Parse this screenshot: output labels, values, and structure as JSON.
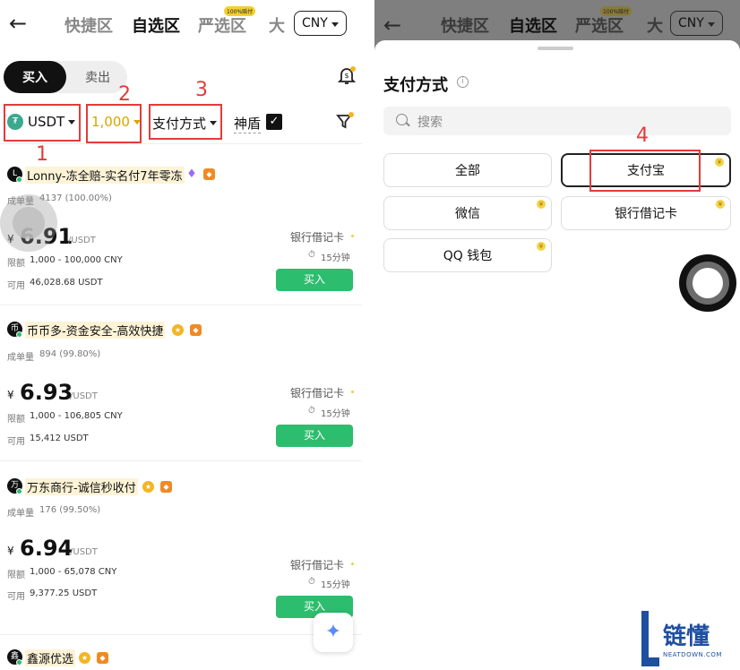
{
  "left": {
    "header": {
      "back": "←",
      "tabs": [
        "快捷区",
        "自选区",
        "严选区",
        "大"
      ],
      "active_tab": "自选区",
      "badge": "100%赔付",
      "currency": "CNY"
    },
    "segment": {
      "buy": "买入",
      "sell": "卖出"
    },
    "filters": {
      "coin": "USDT",
      "amount": "1,000",
      "payment": "支付方式",
      "shield": "神盾"
    },
    "annotations": [
      "1",
      "2",
      "3"
    ],
    "merchants": [
      {
        "avatar": "L",
        "name": "Lonny-冻全赔-实名付7年零冻",
        "stats_label": "成单量",
        "stats": "4137 (100.00%)",
        "currency_symbol": "¥",
        "price": "6.91",
        "unit": "/USDT",
        "pay_method": "银行借记卡",
        "time": "15分钟",
        "limit_label": "限额",
        "limit": "1,000 - 100,000 CNY",
        "avail_label": "可用",
        "avail": "46,028.68 USDT",
        "buy": "买入"
      },
      {
        "avatar": "币",
        "name": "币币多-资金安全-高效快捷",
        "stats_label": "成单量",
        "stats": "894 (99.80%)",
        "currency_symbol": "¥",
        "price": "6.93",
        "unit": "/USDT",
        "pay_method": "银行借记卡",
        "time": "15分钟",
        "limit_label": "限额",
        "limit": "1,000 - 106,805 CNY",
        "avail_label": "可用",
        "avail": "15,412 USDT",
        "buy": "买入"
      },
      {
        "avatar": "万",
        "name": "万东商行-诚信秒收付",
        "stats_label": "成单量",
        "stats": "176 (99.50%)",
        "currency_symbol": "¥",
        "price": "6.94",
        "unit": "/USDT",
        "pay_method": "银行借记卡",
        "time": "15分钟",
        "limit_label": "限额",
        "limit": "1,000 - 65,078 CNY",
        "avail_label": "可用",
        "avail": "9,377.25 USDT",
        "buy": "买入"
      },
      {
        "avatar": "鑫",
        "name": "鑫源优选"
      }
    ]
  },
  "right": {
    "header": {
      "back": "←",
      "tabs": [
        "快捷区",
        "自选区",
        "严选区",
        "大"
      ],
      "badge": "100%赔付",
      "currency": "CNY"
    },
    "sheet": {
      "title": "支付方式",
      "info": "i",
      "search_placeholder": "搜索",
      "options": [
        "全部",
        "支付宝",
        "微信",
        "银行借记卡",
        "QQ 钱包"
      ],
      "selected": "支付宝",
      "annotation": "4"
    },
    "watermark": {
      "text": "链懂",
      "url": "NEATDOWN.COM"
    }
  },
  "colors": {
    "buy_green": "#2dbd6e",
    "annotation_red": "#e33b3b",
    "watermark_blue": "#1e4fa0"
  }
}
